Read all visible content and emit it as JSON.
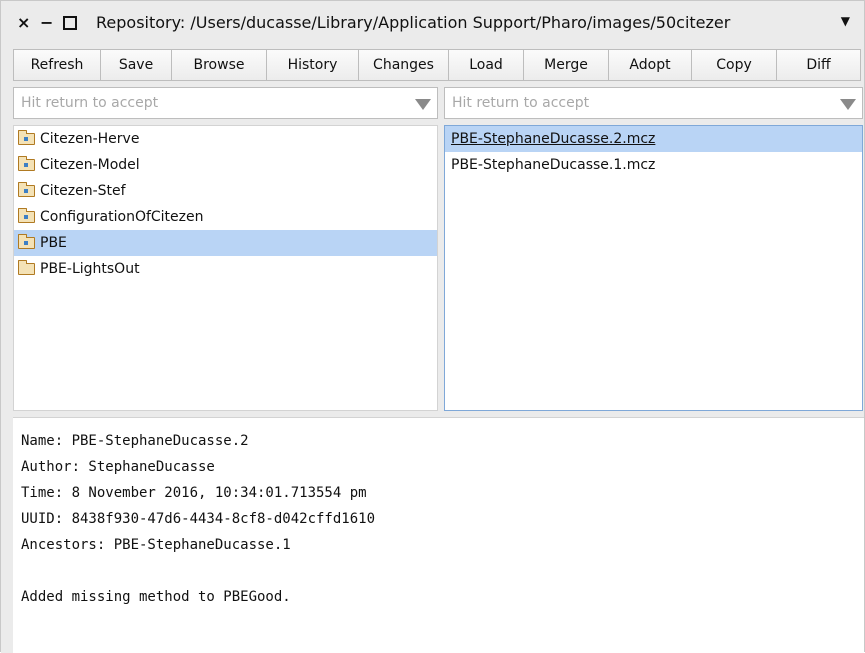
{
  "window": {
    "title": "Repository: /Users/ducasse/Library/Application Support/Pharo/images/50citezer",
    "close_glyph": "×",
    "minimize_glyph": "−",
    "menu_glyph": "▼"
  },
  "toolbar": {
    "buttons": [
      "Refresh",
      "Save",
      "Browse",
      "History",
      "Changes",
      "Load",
      "Merge",
      "Adopt",
      "Copy",
      "Diff"
    ]
  },
  "left_search": {
    "placeholder": "Hit return to accept",
    "value": ""
  },
  "right_search": {
    "placeholder": "Hit return to accept",
    "value": ""
  },
  "packages": [
    {
      "label": "Citezen-Herve",
      "icon": "package-folder-icon"
    },
    {
      "label": "Citezen-Model",
      "icon": "package-folder-icon"
    },
    {
      "label": "Citezen-Stef",
      "icon": "package-folder-icon"
    },
    {
      "label": "ConfigurationOfCitezen",
      "icon": "package-folder-icon"
    },
    {
      "label": "PBE",
      "icon": "package-folder-icon",
      "selected": true
    },
    {
      "label": "PBE-LightsOut",
      "icon": "folder-icon"
    }
  ],
  "versions": [
    {
      "label": "PBE-StephaneDucasse.2.mcz",
      "selected": true
    },
    {
      "label": "PBE-StephaneDucasse.1.mcz"
    }
  ],
  "info": {
    "name": "Name: PBE-StephaneDucasse.2",
    "author": "Author: StephaneDucasse",
    "time": "Time: 8 November 2016, 10:34:01.713554 pm",
    "uuid": "UUID: 8438f930-47d6-4434-8cf8-d042cffd1610",
    "ancestors": "Ancestors: PBE-StephaneDucasse.1",
    "message": "Added missing method to PBEGood."
  },
  "colors": {
    "selection": "#b9d4f5",
    "background": "#ebebeb"
  }
}
